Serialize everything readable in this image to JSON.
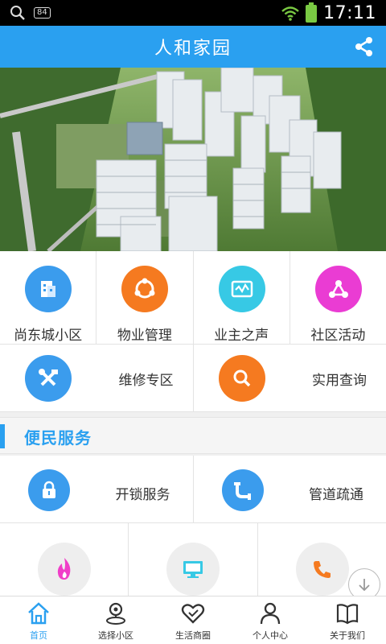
{
  "status_bar": {
    "time": "17:11",
    "badge": "84",
    "icons": [
      "search-icon",
      "wifi-icon",
      "battery-icon"
    ]
  },
  "header": {
    "title": "人和家园",
    "share_icon": "share-icon"
  },
  "banner": {
    "icon": "residential-complex-aerial-photo"
  },
  "colors": {
    "primary": "#2aa0f0",
    "orange": "#f57a20",
    "teal": "#37c9e5",
    "magenta": "#ea3cd3",
    "blue": "#3b9ced",
    "pink": "#f03ec8"
  },
  "main_grid": [
    {
      "label": "尚东城小区",
      "icon": "building-icon",
      "color": "#3b9ced"
    },
    {
      "label": "物业管理",
      "icon": "share-circle-icon",
      "color": "#f57a20"
    },
    {
      "label": "业主之声",
      "icon": "voice-icon",
      "color": "#37c9e5"
    },
    {
      "label": "社区活动",
      "icon": "network-icon",
      "color": "#ea3cd3"
    }
  ],
  "secondary_grid": [
    {
      "label": "维修专区",
      "icon": "tools-icon",
      "color": "#3b9ced"
    },
    {
      "label": "实用查询",
      "icon": "search-icon",
      "color": "#f57a20"
    }
  ],
  "section": {
    "title": "便民服务"
  },
  "services": [
    {
      "label": "开锁服务",
      "icon": "lock-icon",
      "color": "#3b9ced"
    },
    {
      "label": "管道疏通",
      "icon": "pipe-icon",
      "color": "#3b9ced"
    }
  ],
  "services_row2": [
    {
      "icon": "flame-icon",
      "color": "#f03ec8"
    },
    {
      "icon": "monitor-icon",
      "color": "#37c9e5"
    },
    {
      "icon": "phone-icon",
      "color": "#f57a20"
    }
  ],
  "tab_bar": [
    {
      "label": "首页",
      "icon": "home-icon",
      "active": true
    },
    {
      "label": "选择小区",
      "icon": "location-icon",
      "active": false
    },
    {
      "label": "生活商圈",
      "icon": "heart-icon",
      "active": false
    },
    {
      "label": "个人中心",
      "icon": "person-icon",
      "active": false
    },
    {
      "label": "关于我们",
      "icon": "book-icon",
      "active": false
    }
  ]
}
